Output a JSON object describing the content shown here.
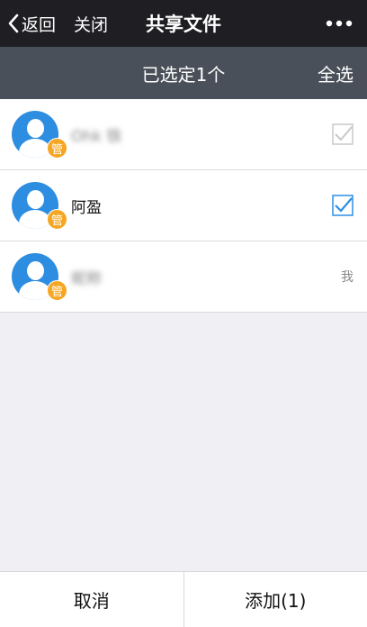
{
  "nav": {
    "back_label": "返回",
    "close_label": "关闭",
    "title": "共享文件",
    "more_icon": "more-dots-icon"
  },
  "selection": {
    "count_label": "已选定1个",
    "select_all_label": "全选"
  },
  "members": [
    {
      "name": "Ohk 铁",
      "badge": "管",
      "checked": false,
      "blurred": true
    },
    {
      "name": "阿盈",
      "badge": "管",
      "checked": true,
      "blurred": false
    },
    {
      "name": "昵称",
      "badge": "管",
      "checked": null,
      "me_label": "我",
      "blurred": true
    }
  ],
  "footer": {
    "cancel_label": "取消",
    "add_label": "添加(1)"
  },
  "colors": {
    "nav_bg": "#1f1f23",
    "subbar_bg": "#4a5059",
    "avatar_blue": "#2d8de0",
    "badge_orange": "#f5a623",
    "check_blue": "#2b8fe6",
    "check_gray": "#c8c8c8"
  }
}
